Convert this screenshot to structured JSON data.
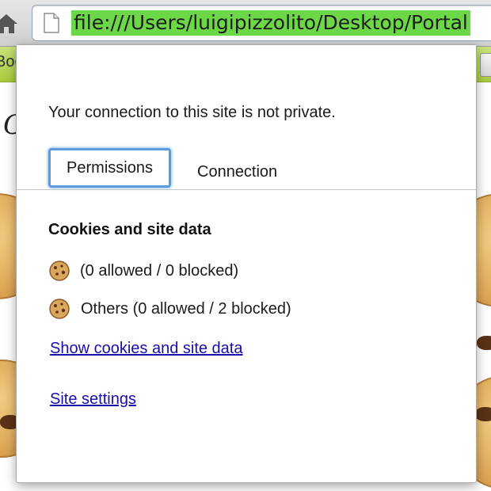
{
  "browser": {
    "url": "file:///Users/luigipizzolito/Desktop/Portal",
    "bookmark_partial": "Boo",
    "page_glyph": "C"
  },
  "popup": {
    "connection_message": "Your connection to this site is not private.",
    "tabs": [
      {
        "label": "Permissions",
        "selected": true
      },
      {
        "label": "Connection",
        "selected": false
      }
    ],
    "section_title": "Cookies and site data",
    "cookie_rows": [
      {
        "icon": "cookie-icon",
        "text": " (0 allowed / 0 blocked)"
      },
      {
        "icon": "cookie-icon",
        "text": "Others (0 allowed / 2 blocked)"
      }
    ],
    "show_cookies_link": "Show cookies and site data",
    "site_settings_link": "Site settings"
  },
  "colors": {
    "url_highlight": "#6cd848",
    "tab_focus_ring": "#5b9be0",
    "link": "#1a0dab",
    "bookmarks_bar": "#b5d450"
  }
}
